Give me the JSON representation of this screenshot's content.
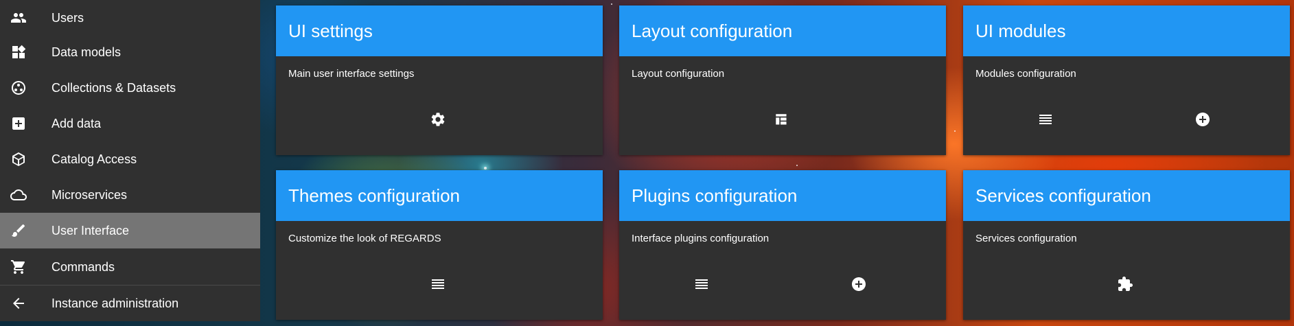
{
  "sidebar": {
    "items": [
      {
        "label": "Users",
        "icon": "users-icon",
        "active": false
      },
      {
        "label": "Data models",
        "icon": "dashboard-icon",
        "active": false
      },
      {
        "label": "Collections & Datasets",
        "icon": "collections-icon",
        "active": false
      },
      {
        "label": "Add data",
        "icon": "add-box-icon",
        "active": false
      },
      {
        "label": "Catalog Access",
        "icon": "catalog-icon",
        "active": false
      },
      {
        "label": "Microservices",
        "icon": "cloud-icon",
        "active": false
      },
      {
        "label": "User Interface",
        "icon": "brush-icon",
        "active": true
      },
      {
        "label": "Commands",
        "icon": "cart-icon",
        "active": false
      },
      {
        "label": "Instance administration",
        "icon": "arrow-back-icon",
        "active": false
      }
    ],
    "active_color": "#757575",
    "background": "#303030"
  },
  "cards": [
    {
      "title": "UI settings",
      "subtitle": "Main user interface settings",
      "actions": [
        "gear-icon"
      ]
    },
    {
      "title": "Layout configuration",
      "subtitle": "Layout configuration",
      "actions": [
        "layout-icon"
      ]
    },
    {
      "title": "UI modules",
      "subtitle": "Modules configuration",
      "actions": [
        "list-icon",
        "add-circle-icon"
      ]
    },
    {
      "title": "Themes configuration",
      "subtitle": "Customize the look of REGARDS",
      "actions": [
        "list-icon"
      ]
    },
    {
      "title": "Plugins configuration",
      "subtitle": "Interface plugins configuration",
      "actions": [
        "list-icon",
        "add-circle-icon"
      ]
    },
    {
      "title": "Services configuration",
      "subtitle": "Services configuration",
      "actions": [
        "extension-icon"
      ]
    }
  ],
  "colors": {
    "card_header": "#2196f3",
    "card_body": "#303030"
  }
}
